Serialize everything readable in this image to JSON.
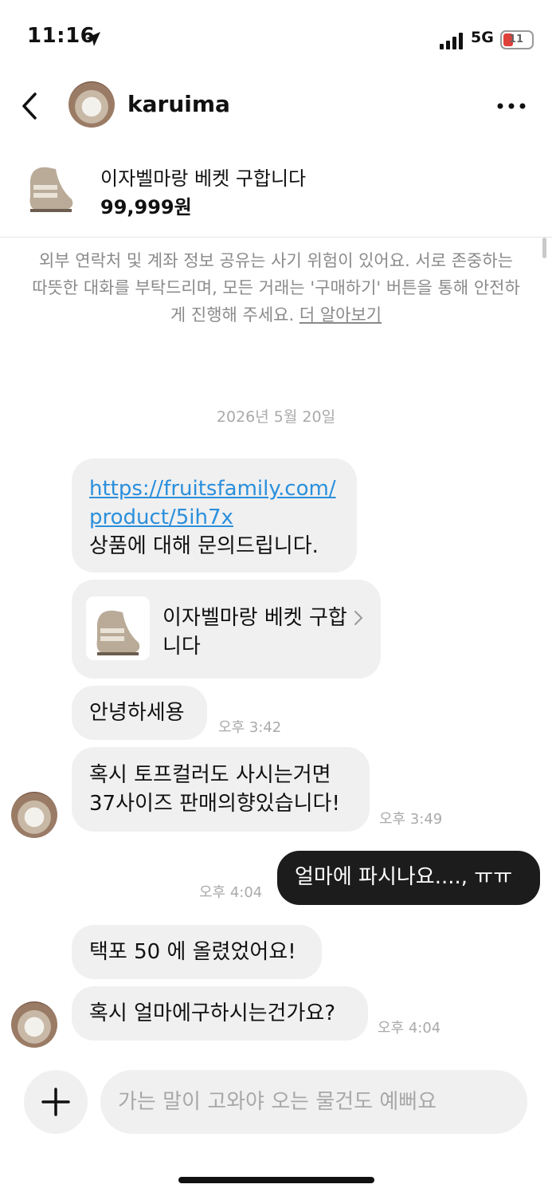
{
  "status_bar": {
    "time": "11:16",
    "network": "5G",
    "battery": "11"
  },
  "header": {
    "username": "karuima"
  },
  "product": {
    "title": "이자벨마랑 베켓 구합니다",
    "price": "99,999원"
  },
  "notice": {
    "text": "외부 연락처 및 계좌 정보 공유는 사기 위험이 있어요. 서로 존중하는 따뜻한 대화를 부탁드리며, 모든 거래는 '구매하기' 버튼을 통해 안전하게 진행해 주세요.",
    "link": "더 알아보기"
  },
  "date_divider": "2026년 5월 20일",
  "messages": [
    {
      "url_line1": "https://fruitsfamily.com/",
      "url_line2": "product/5ih7x",
      "text": "상품에 대해 문의드립니다."
    },
    {
      "card_title": "이자벨마랑 베켓 구합니다"
    },
    {
      "text": "안녕하세용",
      "time": "오후 3:42"
    },
    {
      "text": "혹시 토프컬러도 사시는거면 37사이즈 판매의향있습니다!",
      "time": "오후 3:49"
    },
    {
      "text": "얼마에 파시나요...., ㅠㅠ",
      "time": "오후 4:04"
    },
    {
      "text": "택포 50 에 올렸었어요!"
    },
    {
      "text": "혹시 얼마에구하시는건가요?",
      "time": "오후 4:04"
    }
  ],
  "composer": {
    "placeholder": "가는 말이 고와야 오는 물건도 예뻐요",
    "value": ""
  },
  "icons": [
    "location-arrow-icon",
    "signal-icon",
    "battery-icon",
    "back-chevron-icon",
    "more-icon",
    "chevron-right-icon",
    "plus-icon"
  ]
}
